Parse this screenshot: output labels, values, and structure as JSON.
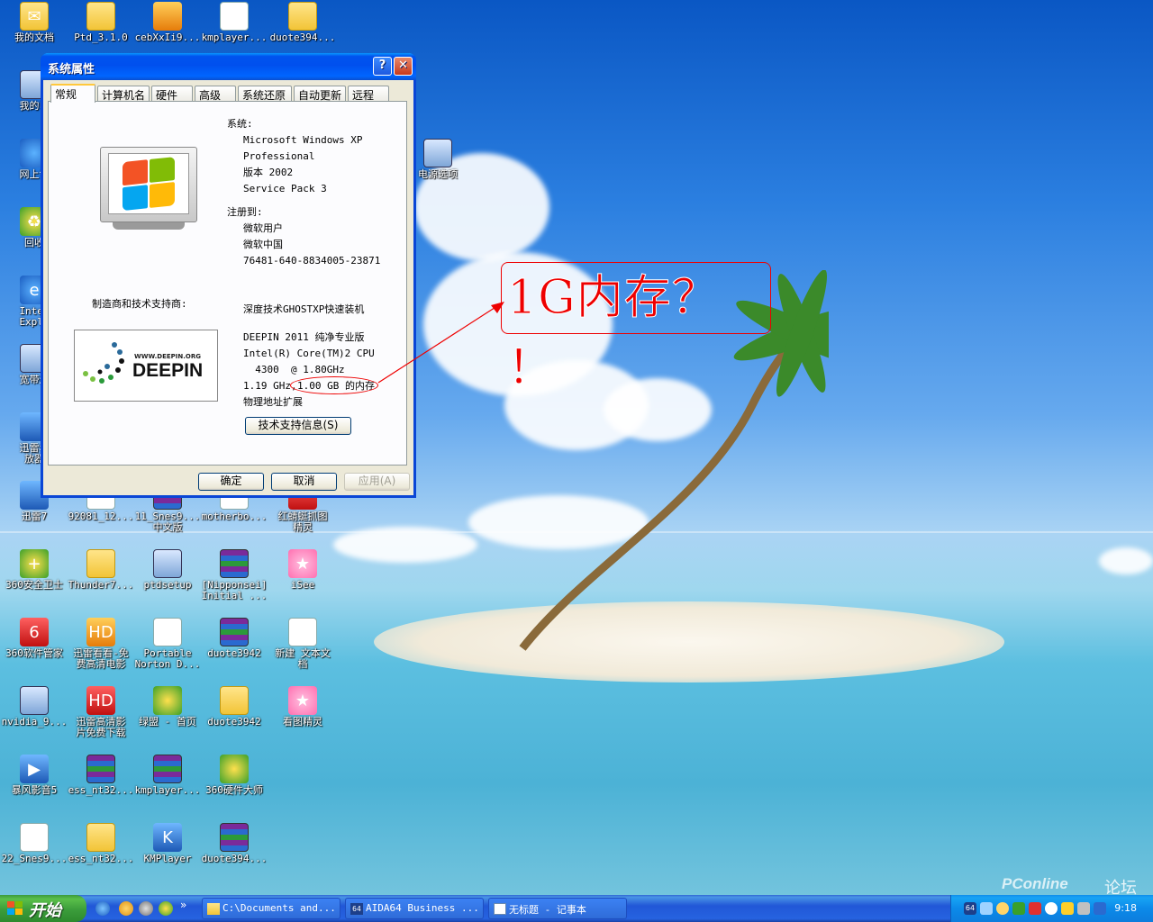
{
  "desktop": {
    "icons": [
      {
        "label": "我的文档",
        "icon": "my-documents-icon"
      },
      {
        "label": "Ptd_3.1.0",
        "icon": "folder-icon"
      },
      {
        "label": "cebXxIi9...",
        "icon": "archive-file-icon"
      },
      {
        "label": "kmplayer...",
        "icon": "temp-file-icon"
      },
      {
        "label": "duote394...",
        "icon": "folder-icon"
      },
      {
        "label": "我的电",
        "icon": "my-computer-icon"
      },
      {
        "label": "网上邻",
        "icon": "network-icon"
      },
      {
        "label": "回收",
        "icon": "recycle-bin-icon"
      },
      {
        "label": "Inter\nExplo",
        "icon": "ie-icon"
      },
      {
        "label": "宽带连",
        "icon": "broadband-icon"
      },
      {
        "label": "迅雷看\n放器",
        "icon": "xunlei-player-icon"
      },
      {
        "label": "迅雷7",
        "icon": "xunlei-icon"
      },
      {
        "label": "92081_12...",
        "icon": "file-icon"
      },
      {
        "label": "11_Snes9...\n中文版",
        "icon": "rar-icon"
      },
      {
        "label": "motherbo...",
        "icon": "file-icon"
      },
      {
        "label": "红蜻蜓抓图\n精灵",
        "icon": "screenshot-icon"
      },
      {
        "label": "电源选项",
        "icon": "power-options-icon"
      },
      {
        "label": "360安全卫士",
        "icon": "360-safe-icon"
      },
      {
        "label": "Thunder7...",
        "icon": "thunder-installer-icon"
      },
      {
        "label": "ptdsetup",
        "icon": "setup-icon"
      },
      {
        "label": "[Nipponsei]\nInitial ...",
        "icon": "rar-icon"
      },
      {
        "label": "iSee",
        "icon": "isee-icon"
      },
      {
        "label": "360软件管家",
        "icon": "360-manager-icon"
      },
      {
        "label": "迅雷看看-免\n费高清电影",
        "icon": "xunlei-kankan-icon"
      },
      {
        "label": "Portable\nNorton D...",
        "icon": "norton-icon"
      },
      {
        "label": "duote3942",
        "icon": "rar-icon"
      },
      {
        "label": "新建 文本文\n档",
        "icon": "text-file-icon"
      },
      {
        "label": "nvidia_9...",
        "icon": "nvidia-setup-icon"
      },
      {
        "label": "迅雷高清影\n片免费下载",
        "icon": "xunlei-hd-icon"
      },
      {
        "label": "绿盟 - 首页",
        "icon": "lvmeng-icon"
      },
      {
        "label": "duote3942",
        "icon": "folder-icon"
      },
      {
        "label": "看图精灵",
        "icon": "image-viewer-icon"
      },
      {
        "label": "暴风影音5",
        "icon": "baofeng-icon"
      },
      {
        "label": "ess_nt32...",
        "icon": "rar-icon"
      },
      {
        "label": "kmplayer...",
        "icon": "rar-icon"
      },
      {
        "label": "360硬件大师",
        "icon": "360-hardware-icon"
      },
      {
        "label": "22_Snes9...",
        "icon": "temp-file-icon"
      },
      {
        "label": "ess_nt32...",
        "icon": "folder-icon"
      },
      {
        "label": "KMPlayer",
        "icon": "kmplayer-icon"
      },
      {
        "label": "duote394...",
        "icon": "rar-icon"
      }
    ]
  },
  "dialog": {
    "title": "系统属性",
    "help_btn": "?",
    "close_btn": "✕",
    "tabs": [
      "常规",
      "计算机名",
      "硬件",
      "高级",
      "系统还原",
      "自动更新",
      "远程"
    ],
    "system_label": "系统:",
    "system_lines": [
      "Microsoft Windows XP",
      "Professional",
      "版本 2002",
      "Service Pack 3"
    ],
    "registered_label": "注册到:",
    "registered_lines": [
      "微软用户",
      "微软中国",
      "76481-640-8834005-23871"
    ],
    "manufacturer_label": "制造商和技术支持商:",
    "manufacturer_name": "深度技术GHOSTXP快速装机",
    "deepin_url": "WWW.DEEPIN.ORG",
    "deepin_brand": "DEEPIN",
    "spec_lines": [
      "DEEPIN 2011 纯净专业版",
      "Intel(R) Core(TM)2 CPU",
      "  4300  @ 1.80GHz"
    ],
    "spec_ghz": "1.19 GHz,",
    "spec_mem": "1.00 GB 的内存",
    "spec_pae": "物理地址扩展",
    "support_button": "技术支持信息(S)",
    "ok": "确定",
    "cancel": "取消",
    "apply": "应用(A)"
  },
  "annotation": {
    "text": "1G内存？ ！",
    "color": "#e00000"
  },
  "taskbar": {
    "start_label": "开始",
    "quicklaunch_more": "»",
    "tasks": [
      {
        "label": "C:\\Documents and...",
        "icon": "folder-icon"
      },
      {
        "label": "AIDA64 Business ...",
        "icon": "aida64-icon"
      },
      {
        "label": "无标题 - 记事本",
        "icon": "notepad-icon"
      }
    ],
    "clock": "9:18",
    "tray_badge": "64"
  },
  "watermark": {
    "brand": "PConline",
    "forum": "论坛"
  }
}
